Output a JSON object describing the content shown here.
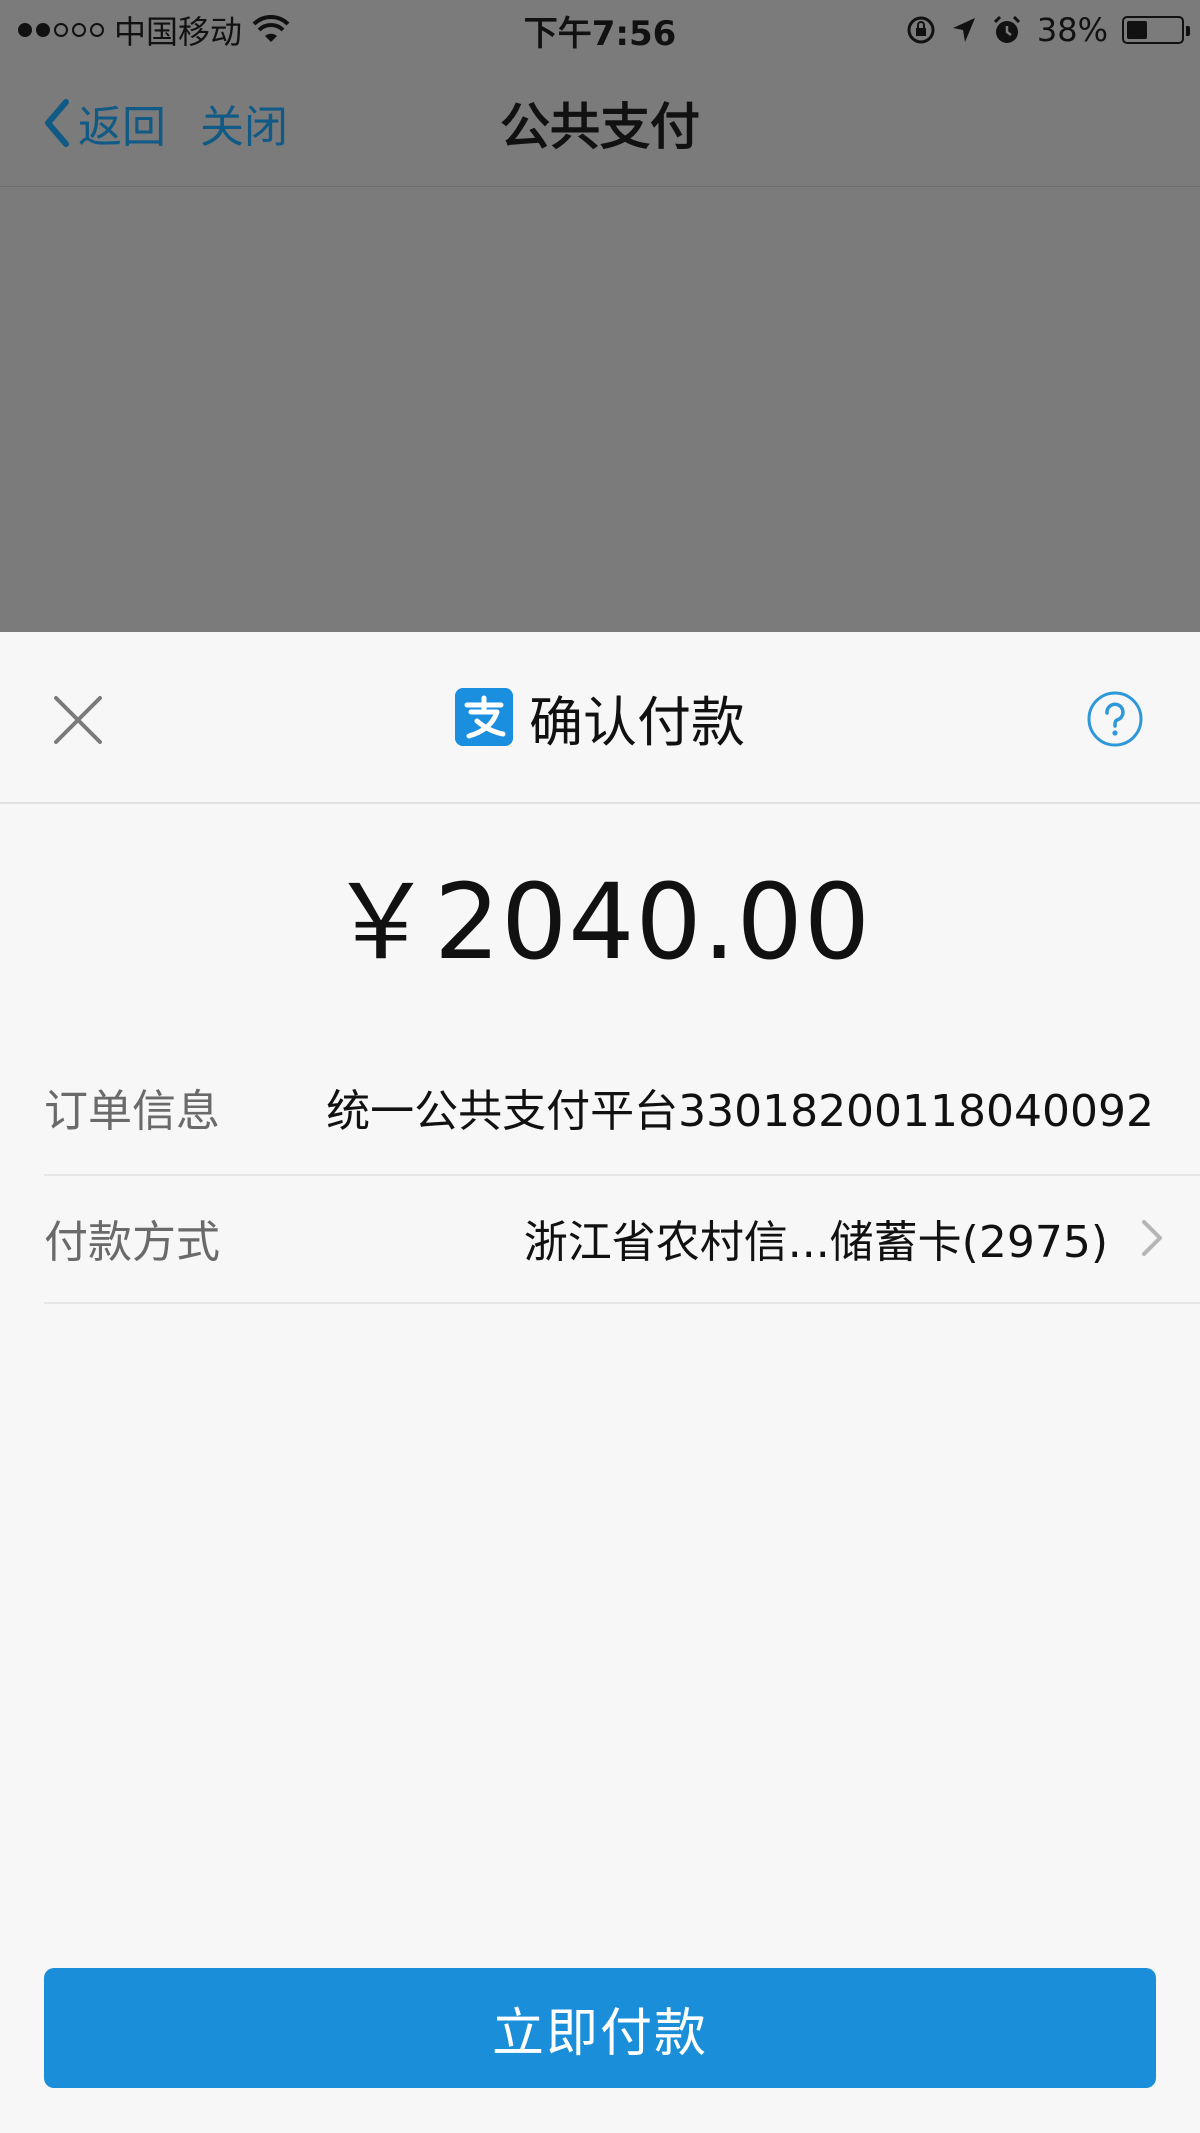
{
  "status_bar": {
    "carrier": "中国移动",
    "time": "下午7:56",
    "battery": "38%",
    "battery_level": 0.38
  },
  "nav": {
    "back_label": "返回",
    "close_label": "关闭",
    "title": "公共支付"
  },
  "sheet": {
    "title": "确认付款",
    "amount": "￥2040.00",
    "order_label": "订单信息",
    "order_value": "统一公共支付平台33018200118040092",
    "payment_label": "付款方式",
    "payment_value": "浙江省农村信...储蓄卡(2975)",
    "pay_button": "立即付款"
  },
  "colors": {
    "accent": "#1a8ed9",
    "nav_link": "#125a86",
    "overlay": "#7b7b7b"
  },
  "icons": [
    "wifi-icon",
    "orientation-lock-icon",
    "location-arrow-icon",
    "alarm-icon",
    "battery-icon",
    "chevron-left-icon",
    "close-icon",
    "alipay-logo-icon",
    "help-icon",
    "chevron-right-icon"
  ]
}
